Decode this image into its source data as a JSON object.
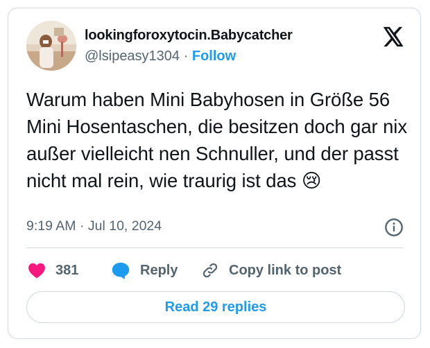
{
  "author": {
    "display_name": "lookingforoxytocin.Babycatcher",
    "handle": "@lsipeasy1304",
    "separator": " · ",
    "follow_label": "Follow"
  },
  "tweet": {
    "text": "Warum haben Mini Babyhosen in Größe 56 Mini Hosentaschen, die besitzen doch gar nix außer vielleicht nen Schnuller, und der passt nicht mal rein, wie traurig ist das 😢",
    "timestamp": "9:19 AM · Jul 10, 2024"
  },
  "actions": {
    "like_count": "381",
    "reply_label": "Reply",
    "copy_label": "Copy link to post"
  },
  "footer": {
    "read_replies_label": "Read 29 replies"
  },
  "icons": {
    "logo": "x-logo-icon",
    "info": "info-icon",
    "like": "heart-icon",
    "reply": "speech-bubble-icon",
    "copy": "link-icon"
  },
  "colors": {
    "accent": "#1d9bf0",
    "like": "#f91880",
    "muted": "#536471",
    "border": "#cfd9de"
  }
}
